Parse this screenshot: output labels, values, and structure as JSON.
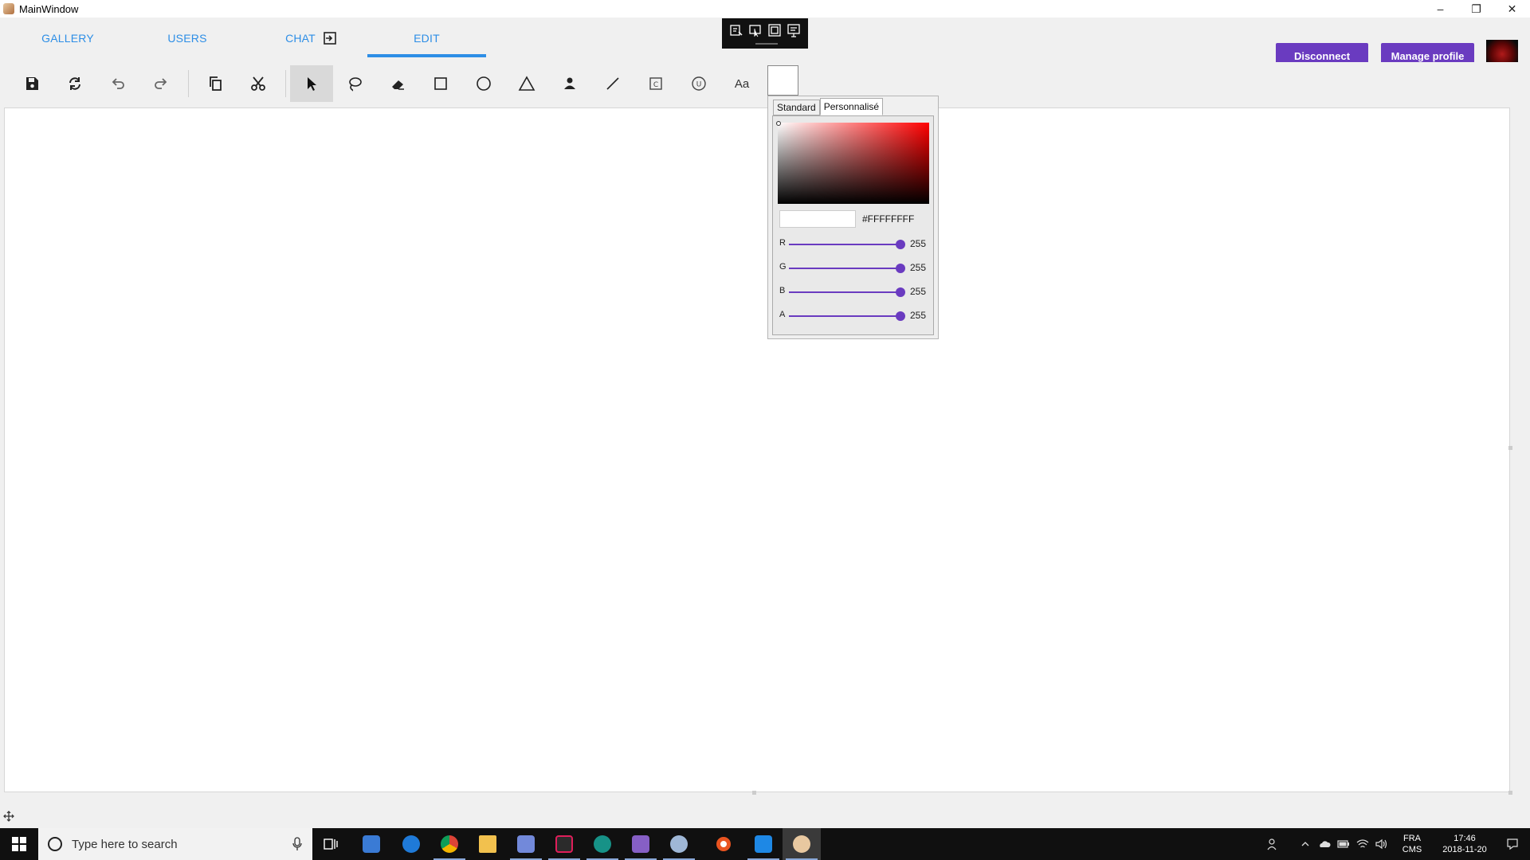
{
  "window": {
    "title": "MainWindow",
    "controls": {
      "minimize": "–",
      "restore": "❐",
      "close": "✕"
    }
  },
  "nav": {
    "tabs": [
      {
        "label": "GALLERY"
      },
      {
        "label": "USERS"
      },
      {
        "label": "CHAT"
      },
      {
        "label": "EDIT"
      }
    ],
    "active_tab": "EDIT",
    "disconnect_label": "Disconnect",
    "manage_profile_label": "Manage profile"
  },
  "floating_toolbar": {
    "icons": [
      "insert-ink-icon",
      "select-ink-icon",
      "capture-region-icon",
      "capture-window-icon"
    ]
  },
  "toolbar": {
    "tools": [
      "save",
      "refresh",
      "undo",
      "redo",
      "copy",
      "cut",
      "select",
      "lasso",
      "eraser",
      "rectangle",
      "ellipse",
      "triangle",
      "person",
      "line",
      "class-shape",
      "use-case",
      "text"
    ],
    "selected_tool": "select",
    "text_tool_label": "Aa",
    "current_color": "#FFFFFF"
  },
  "color_picker": {
    "tabs": [
      {
        "label": "Standard"
      },
      {
        "label": "Personnalisé"
      }
    ],
    "active_tab": "Personnalisé",
    "hue_color": "#FF0000",
    "hex_value": "#FFFFFFFF",
    "channels": [
      {
        "label": "R",
        "value": "255"
      },
      {
        "label": "G",
        "value": "255"
      },
      {
        "label": "B",
        "value": "255"
      },
      {
        "label": "A",
        "value": "255"
      }
    ],
    "accent": "#6A3BC0"
  },
  "taskbar": {
    "search_placeholder": "Type here to search",
    "apps": [
      "task-view",
      "windows-store",
      "edge",
      "chrome",
      "file-explorer",
      "discord",
      "slack",
      "gitkraken",
      "visual-studio",
      "paint-app",
      "ubuntu",
      "vscode",
      "poly-paint"
    ],
    "tray": {
      "language_line1": "FRA",
      "language_line2": "CMS",
      "time": "17:46",
      "date": "2018-11-20"
    }
  },
  "colors": {
    "tab_text": "#2D8EE6",
    "primary_button": "#6A3BC0",
    "taskbar": "#101010"
  }
}
